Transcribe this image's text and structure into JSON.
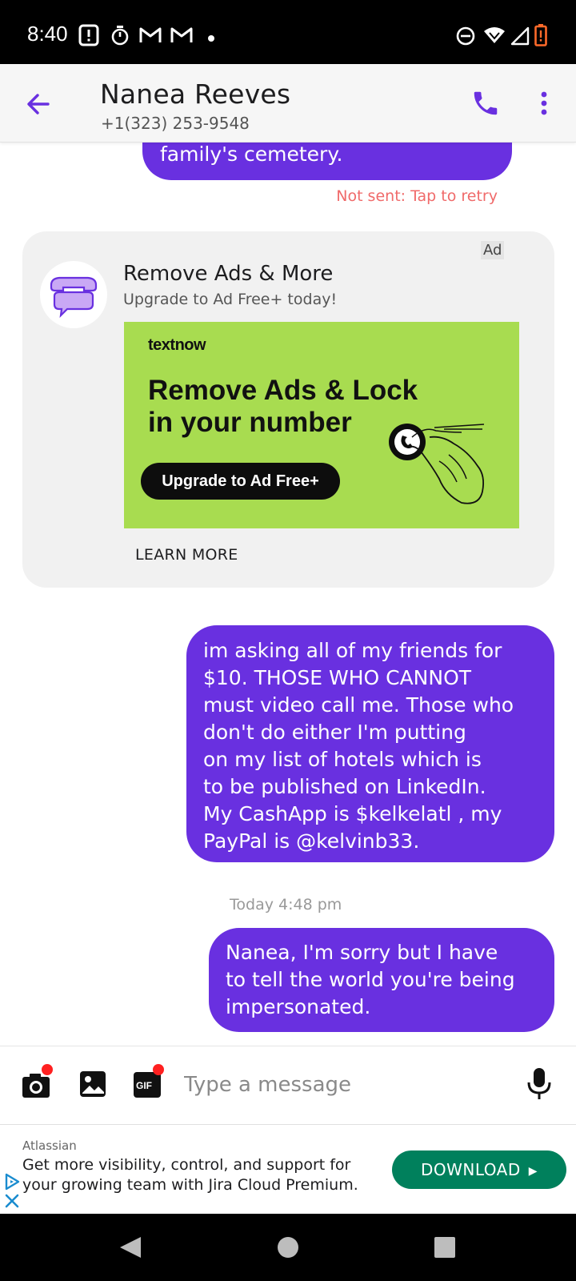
{
  "status_bar": {
    "time": "8:40",
    "left_icons": [
      "notification-alert-icon",
      "timer-icon",
      "gmail-icon",
      "gmail-icon",
      "dot-icon"
    ],
    "right_icons": [
      "do-not-disturb-icon",
      "wifi-icon",
      "signal-icon",
      "battery-low-icon"
    ],
    "battery_color": "#ff6a2a"
  },
  "header": {
    "contact_name": "Nanea Reeves",
    "contact_phone": "+1(323) 253-9548",
    "accent_color": "#6930e0"
  },
  "conversation": {
    "partial_message": "family's cemetery.",
    "not_sent_text": "Not sent: Tap to retry",
    "ad": {
      "label": "Ad",
      "title": "Remove Ads & More",
      "subtitle": "Upgrade to Ad Free+ today!",
      "banner_brand": "textnow",
      "banner_headline": "Remove Ads & Lock in your number",
      "banner_cta": "Upgrade to Ad Free+",
      "banner_color": "#a8dc50",
      "learn_more": "LEARN MORE"
    },
    "messages": [
      {
        "text": "im asking all of my friends for\n$10. THOSE WHO CANNOT\nmust video call me. Those who\ndon't do either I'm putting\non my list of hotels which is\nto be published on LinkedIn.\nMy CashApp is $kelkelatl , my\nPayPal is @kelvinb33."
      },
      {
        "text": "Nanea, I'm sorry but I have\nto tell the world you're being\nimpersonated."
      }
    ],
    "timestamp": "Today 4:48 pm",
    "bubble_color": "#6930e0"
  },
  "composer": {
    "placeholder": "Type a message",
    "gif_label": "GIF"
  },
  "bottom_ad": {
    "advertiser": "Atlassian",
    "text": "Get more visibility, control, and support for your growing team with Jira Cloud Premium.",
    "button_label": "DOWNLOAD",
    "button_color": "#00805c"
  }
}
